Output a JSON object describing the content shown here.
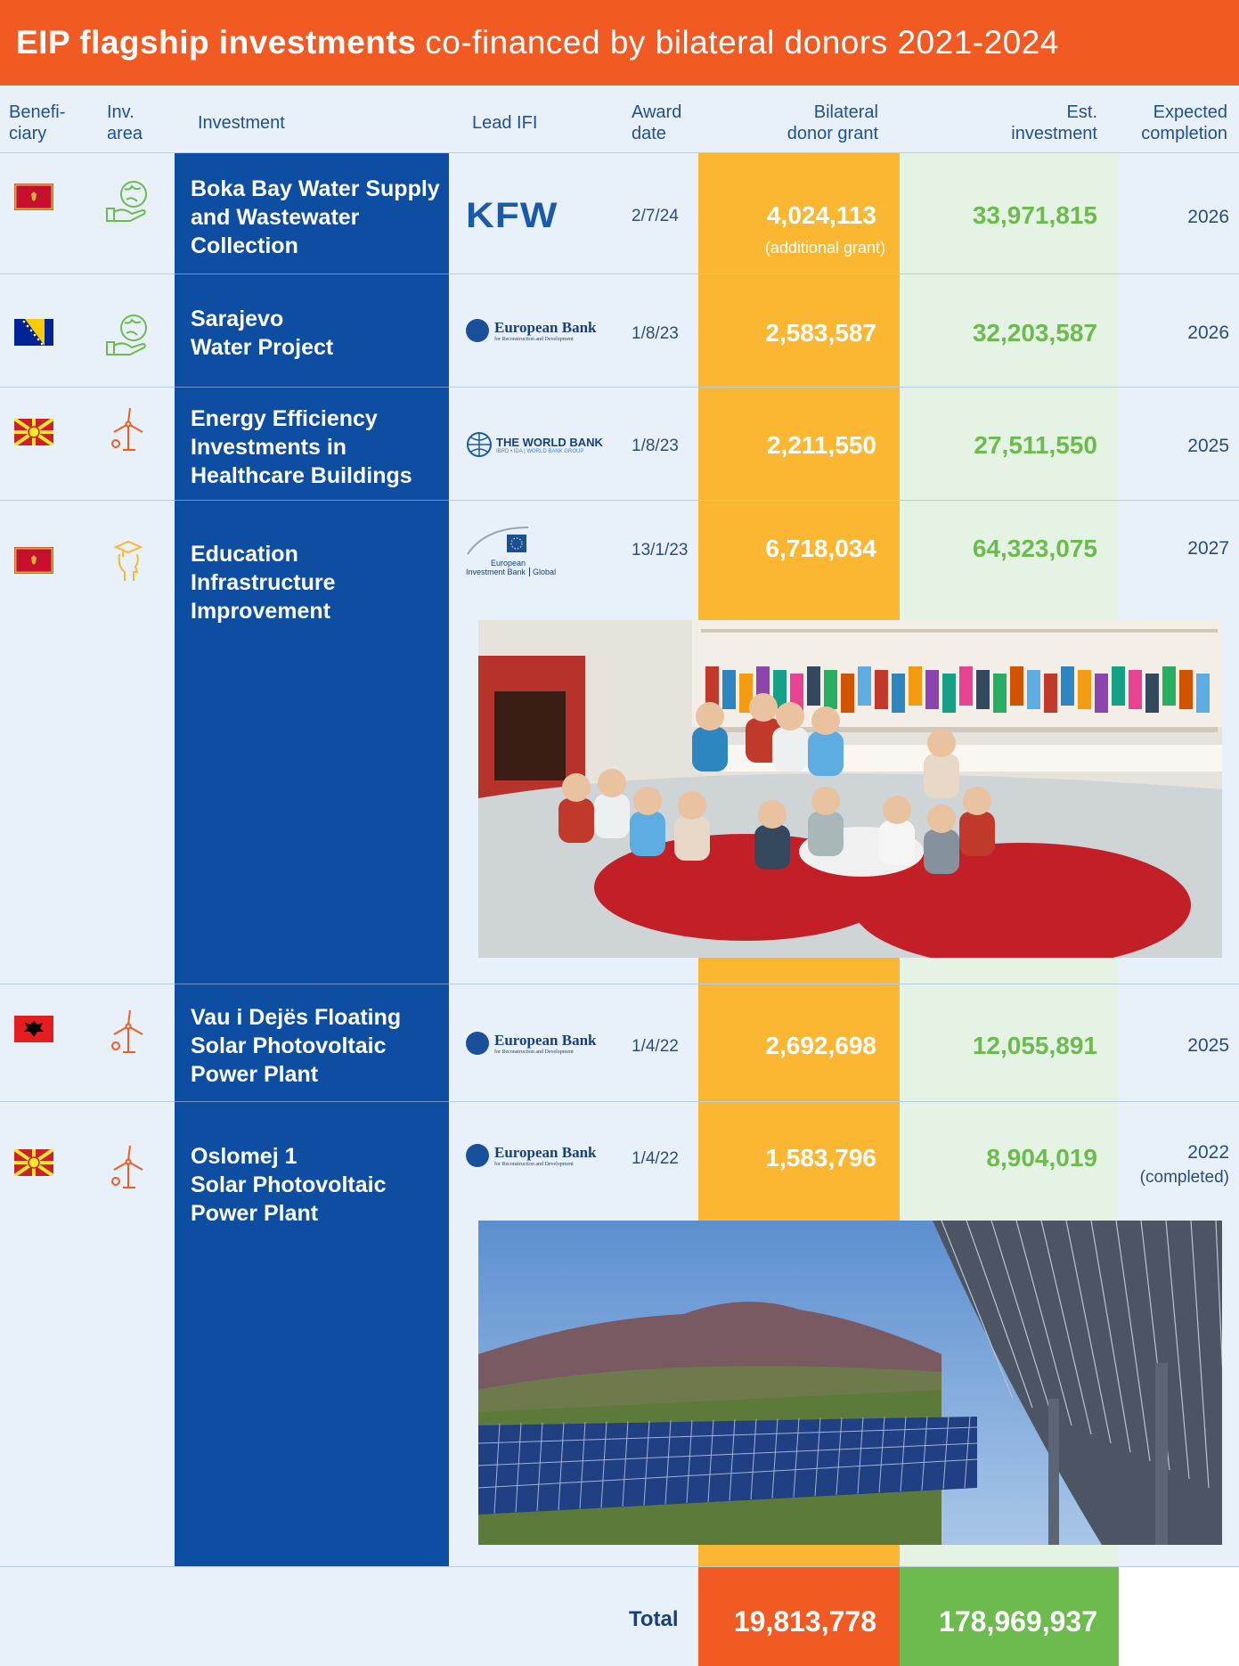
{
  "title": {
    "bold": "EIP flagship investments",
    "rest": "co-financed by bilateral donors 2021-2024"
  },
  "headers": {
    "beneficiary": [
      "Benefi-",
      "ciary"
    ],
    "area": [
      "Inv.",
      "area"
    ],
    "investment": "Investment",
    "lead_ifi": "Lead IFI",
    "award": [
      "Award",
      "date"
    ],
    "grant": [
      "Bilateral",
      "donor grant"
    ],
    "est": [
      "Est.",
      "investment"
    ],
    "completion": [
      "Expected",
      "completion"
    ]
  },
  "colors": {
    "orange": "#f15a22",
    "navy": "#0d4ea2",
    "amber": "#fbb732",
    "green": "#6dbb4e",
    "light": "#e8f1fa"
  },
  "rows": [
    {
      "flag": "montenegro-flag",
      "area_icon": "water-globe-hand-icon",
      "investment": [
        "Boka Bay Water Supply",
        "and Wastewater",
        "Collection"
      ],
      "ifi": "KFW",
      "date": "2/7/24",
      "grant": "4,024,113",
      "grant_note": "(additional grant)",
      "est": "33,971,815",
      "completion": "2026"
    },
    {
      "flag": "bosnia-flag",
      "area_icon": "water-globe-hand-icon",
      "investment": [
        "Sarajevo",
        "Water Project"
      ],
      "ifi": "European Bank",
      "ifi_sub": "for Reconstruction and Development",
      "date": "1/8/23",
      "grant": "2,583,587",
      "est": "32,203,587",
      "completion": "2026"
    },
    {
      "flag": "north-macedonia-flag",
      "area_icon": "wind-turbine-icon",
      "investment": [
        "Energy Efficiency",
        "Investments in",
        "Healthcare Buildings"
      ],
      "ifi": "THE WORLD BANK",
      "ifi_sub": "IBRD • IDA | WORLD BANK GROUP",
      "date": "1/8/23",
      "grant": "2,211,550",
      "est": "27,511,550",
      "completion": "2025"
    },
    {
      "flag": "montenegro-flag",
      "area_icon": "education-head-icon",
      "investment": [
        "Education",
        "Infrastructure",
        "Improvement"
      ],
      "ifi": "European",
      "ifi2": "Investment Bank",
      "ifi_tag": "Global",
      "date": "13/1/23",
      "grant": "6,718,034",
      "est": "64,323,075",
      "completion": "2027"
    },
    {
      "flag": "albania-flag",
      "area_icon": "wind-turbine-icon",
      "investment": [
        "Vau i Dejës Floating",
        "Solar Photovoltaic",
        "Power Plant"
      ],
      "ifi": "European Bank",
      "ifi_sub": "for Reconstruction and Development",
      "date": "1/4/22",
      "grant": "2,692,698",
      "est": "12,055,891",
      "completion": "2025"
    },
    {
      "flag": "north-macedonia-flag",
      "area_icon": "wind-turbine-icon",
      "investment": [
        "Oslomej 1",
        "Solar Photovoltaic",
        "Power Plant"
      ],
      "ifi": "European Bank",
      "ifi_sub": "for Reconstruction and Development",
      "date": "1/4/22",
      "grant": "1,583,796",
      "est": "8,904,019",
      "completion": "2022",
      "completion_note": "(completed)"
    }
  ],
  "total": {
    "label": "Total",
    "grant": "19,813,778",
    "est": "178,969,937"
  }
}
